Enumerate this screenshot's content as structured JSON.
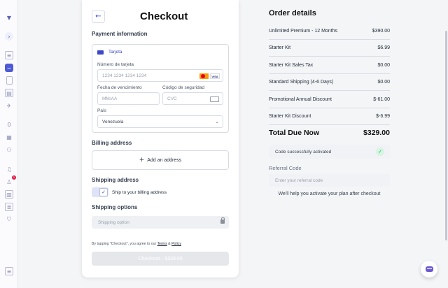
{
  "rail": {
    "icons": [
      "logo-icon",
      "expand-icon",
      "document-icon",
      "add-icon",
      "phone-icon",
      "grid-icon",
      "plane-icon",
      "zero-icon",
      "apps-icon",
      "users-icon",
      "bell-icon",
      "person-alert-icon",
      "book-icon",
      "chat-list-icon",
      "shield-icon",
      "file-icon"
    ],
    "zero_label": "0",
    "notification_count": "1"
  },
  "checkout": {
    "title": "Checkout",
    "payment_info_heading": "Payment information",
    "card_tab_label": "Tarjeta",
    "card_number_label": "Número de tarjeta",
    "card_number_placeholder": "1234 1234 1234 1234",
    "card_brand_visa": "VISA",
    "expiry_label": "Fecha de vencimiento",
    "expiry_placeholder": "MM/AA",
    "cvc_label": "Código de seguridad",
    "cvc_placeholder": "CVC",
    "country_label": "País",
    "country_value": "Venezuela",
    "billing_heading": "Billing address",
    "add_address_label": "Add an address",
    "shipping_heading": "Shipping address",
    "ship_to_billing_label": "Ship to your billing address",
    "shipping_options_heading": "Shipping options",
    "shipping_option_placeholder": "Shipping option",
    "terms_prefix": "By tapping \"Checkout\", you agree to our",
    "terms_link": "Terms",
    "terms_and": "&",
    "policy_link": "Policy",
    "checkout_button_label": "Checkout - $329.00"
  },
  "order": {
    "title": "Order details",
    "items": [
      {
        "name": "Unlimited Premium - 12 Months",
        "price": "$390.00"
      },
      {
        "name": "Starter Kit",
        "price": "$6.99"
      },
      {
        "name": "Starter Kit Sales Tax",
        "price": "$0.00"
      },
      {
        "name": "Standard Shipping (4-6 Days)",
        "price": "$0.00"
      },
      {
        "name": "Promotional Annual Discount",
        "price": "$-61.00"
      },
      {
        "name": "Starter Kit Discount",
        "price": "$-6.99"
      }
    ],
    "total_label": "Total Due Now",
    "total_value": "$329.00",
    "code_status": "Code successfully activated",
    "referral_label": "Referral Code",
    "referral_placeholder": "Enter your referral code",
    "help_text": "We'll help you activate your plan after checkout"
  },
  "colors": {
    "accent": "#3b49c8",
    "rail_active": "#4f5bd5",
    "success": "#16a34a",
    "chat": "#6d5bd0"
  }
}
